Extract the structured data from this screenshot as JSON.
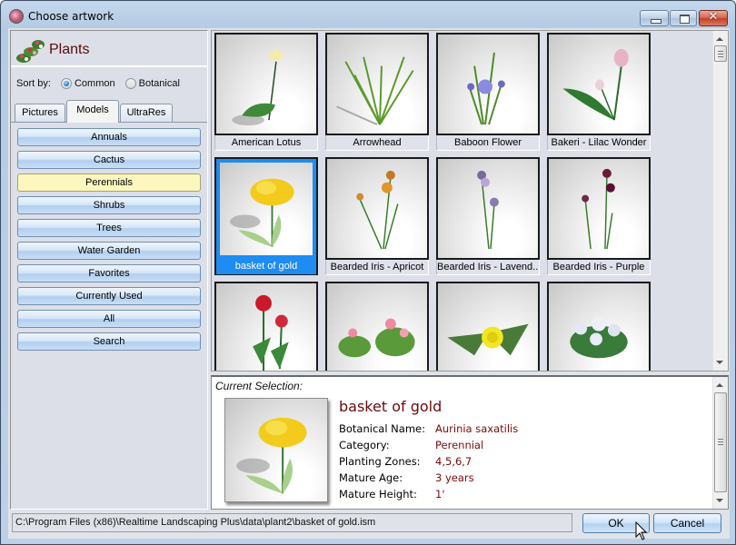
{
  "window": {
    "title": "Choose artwork",
    "controls": {
      "minimize": "minimize",
      "maximize": "maximize",
      "close": "✕"
    }
  },
  "category_panel": {
    "title": "Plants",
    "sort_by_label": "Sort by:",
    "sort_options": [
      {
        "label": "Common",
        "checked": true
      },
      {
        "label": "Botanical",
        "checked": false
      }
    ],
    "tabs": [
      {
        "label": "Pictures",
        "active": false
      },
      {
        "label": "Models",
        "active": true
      },
      {
        "label": "UltraRes",
        "active": false
      }
    ],
    "categories": [
      {
        "label": "Annuals",
        "selected": false
      },
      {
        "label": "Cactus",
        "selected": false
      },
      {
        "label": "Perennials",
        "selected": true
      },
      {
        "label": "Shrubs",
        "selected": false
      },
      {
        "label": "Trees",
        "selected": false
      },
      {
        "label": "Water Garden",
        "selected": false
      },
      {
        "label": "Favorites",
        "selected": false
      },
      {
        "label": "Currently Used",
        "selected": false
      },
      {
        "label": "All",
        "selected": false
      },
      {
        "label": "Search",
        "selected": false
      }
    ]
  },
  "thumbnails": [
    {
      "label": "American Lotus",
      "selected": false,
      "icon": "lotus-plant-icon"
    },
    {
      "label": "Arrowhead",
      "selected": false,
      "icon": "grass-plant-icon"
    },
    {
      "label": "Baboon Flower",
      "selected": false,
      "icon": "blue-flower-icon"
    },
    {
      "label": "Bakeri - Lilac Wonder",
      "selected": false,
      "icon": "tulip-icon"
    },
    {
      "label": "basket of gold",
      "selected": true,
      "icon": "yellow-flower-cluster-icon"
    },
    {
      "label": "Bearded Iris - Apricot",
      "selected": false,
      "icon": "iris-apricot-icon"
    },
    {
      "label": "Bearded Iris - Lavend...",
      "selected": false,
      "icon": "iris-lavender-icon"
    },
    {
      "label": "Bearded Iris - Purple",
      "selected": false,
      "icon": "iris-purple-icon"
    },
    {
      "label": "",
      "selected": false,
      "icon": "red-flower-icon"
    },
    {
      "label": "",
      "selected": false,
      "icon": "pink-begonia-icon"
    },
    {
      "label": "",
      "selected": false,
      "icon": "yellow-rose-icon"
    },
    {
      "label": "",
      "selected": false,
      "icon": "white-hydrangea-icon"
    }
  ],
  "current_selection": {
    "heading": "Current Selection:",
    "name": "basket of gold",
    "properties": [
      {
        "key": "Botanical Name:",
        "value": "Aurinia saxatilis"
      },
      {
        "key": "Category:",
        "value": "Perennial"
      },
      {
        "key": "Planting Zones:",
        "value": "4,5,6,7"
      },
      {
        "key": "Mature Age:",
        "value": "3 years"
      },
      {
        "key": "Mature Height:",
        "value": "1'"
      }
    ]
  },
  "footer": {
    "path": "C:\\Program Files (x86)\\Realtime Landscaping Plus\\data\\plant2\\basket of gold.ism",
    "ok_label": "OK",
    "cancel_label": "Cancel"
  },
  "colors": {
    "selection_blue": "#1e8cf0",
    "selected_category": "#fbf7be",
    "detail_value": "#7a0a0a"
  }
}
